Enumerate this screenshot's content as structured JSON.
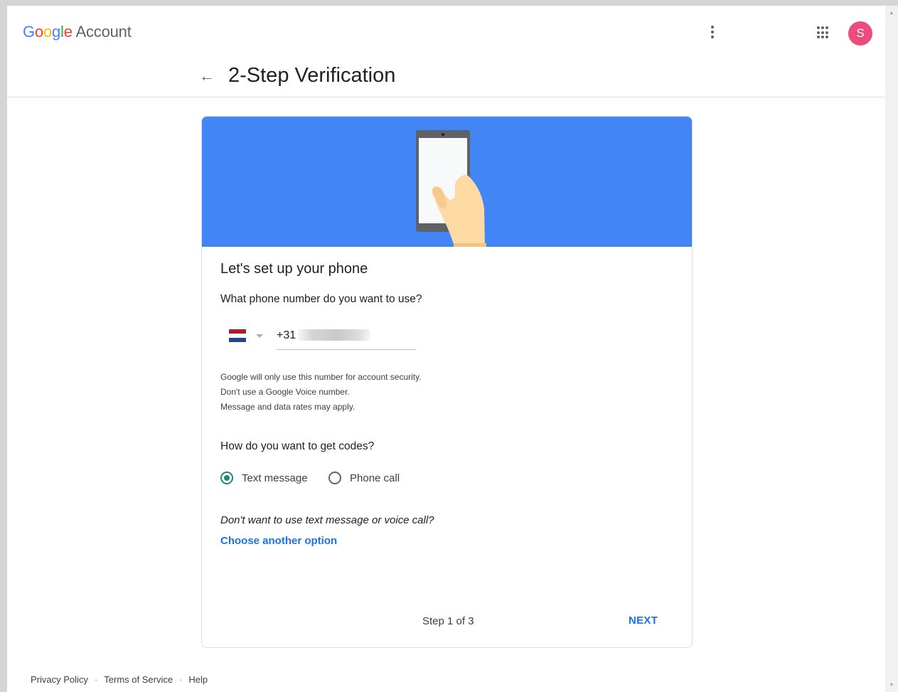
{
  "header": {
    "logo_google": [
      "G",
      "o",
      "o",
      "g",
      "l",
      "e"
    ],
    "logo_word": "Account",
    "avatar_letter": "S",
    "icons": {
      "more": "more-vert-icon",
      "apps": "apps-grid-icon"
    }
  },
  "title_bar": {
    "back_icon": "←",
    "title": "2-Step Verification"
  },
  "card": {
    "heading": "Let's set up your phone",
    "phone_question": "What phone number do you want to use?",
    "country_flag": "Netherlands",
    "phone_prefix": "+31",
    "notes": [
      "Google will only use this number for account security.",
      "Don't use a Google Voice number.",
      "Message and data rates may apply."
    ],
    "codes_question": "How do you want to get codes?",
    "options": [
      {
        "label": "Text message",
        "selected": true
      },
      {
        "label": "Phone call",
        "selected": false
      }
    ],
    "alt_question": "Don't want to use text message or voice call?",
    "alt_link": "Choose another option",
    "step": "Step 1 of 3",
    "next": "NEXT"
  },
  "footer": {
    "links": [
      "Privacy Policy",
      "Terms of Service",
      "Help"
    ],
    "separator": "·"
  },
  "colors": {
    "hero_blue": "#4285f4",
    "link_blue": "#1a73e8",
    "radio_teal": "#1a8b78",
    "avatar_pink": "#ea4c7c"
  }
}
